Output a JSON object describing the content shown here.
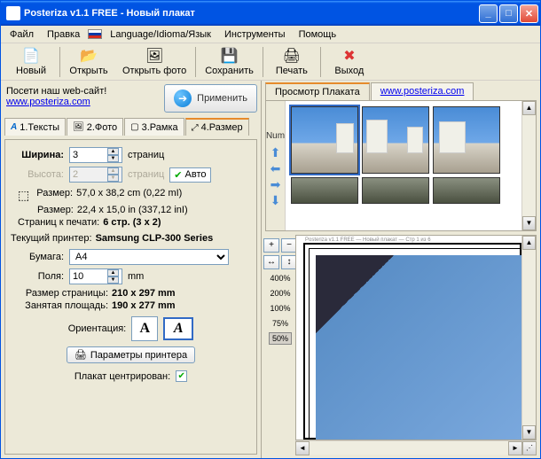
{
  "window": {
    "title": "Posteriza v1.1 FREE - Новый плакат"
  },
  "menu": {
    "file": "Файл",
    "edit": "Правка",
    "lang": "Language/Idioma/Язык",
    "tools": "Инструменты",
    "help": "Помощь"
  },
  "toolbar": {
    "new": "Новый",
    "open": "Открыть",
    "openphoto": "Открыть фото",
    "save": "Сохранить",
    "print": "Печать",
    "exit": "Выход"
  },
  "website": {
    "text": "Посети наш web-сайт!",
    "url": "www.posteriza.com"
  },
  "apply": {
    "label": "Применить"
  },
  "tabs": {
    "t1": "1.Тексты",
    "t2": "2.Фото",
    "t3": "3.Рамка",
    "t4": "4.Размер"
  },
  "size": {
    "width_label": "Ширина:",
    "width_val": "3",
    "pages": "страниц",
    "height_label": "Высота:",
    "height_val": "2",
    "auto": "Авто",
    "size_label": "Размер:",
    "size_cm": "57,0 x 38,2 cm (0,22 mI)",
    "size_in": "22,4 x 15,0 in (337,12 inI)",
    "toprint_label": "Страниц к печати:",
    "toprint_val": "6 стр. (3 x 2)",
    "printer_label": "Текущий принтер:",
    "printer_val": "Samsung CLP-300 Series",
    "paper_label": "Бумага:",
    "paper_val": "A4",
    "margins_label": "Поля:",
    "margins_val": "10",
    "mm": "mm",
    "pagesize_label": "Размер страницы:",
    "pagesize_val": "210 x 297 mm",
    "usedarea_label": "Занятая площадь:",
    "usedarea_val": "190 x 277 mm",
    "orient_label": "Ориентация:",
    "printer_props": "Параметры принтера",
    "centered_label": "Плакат центрирован:"
  },
  "rtabs": {
    "preview": "Просмотр Плаката",
    "web": "www.posteriza.com"
  },
  "thumbs": {
    "num": "Num"
  },
  "zoom": {
    "z400": "400%",
    "z200": "200%",
    "z100": "100%",
    "z75": "75%",
    "z50": "50%"
  }
}
